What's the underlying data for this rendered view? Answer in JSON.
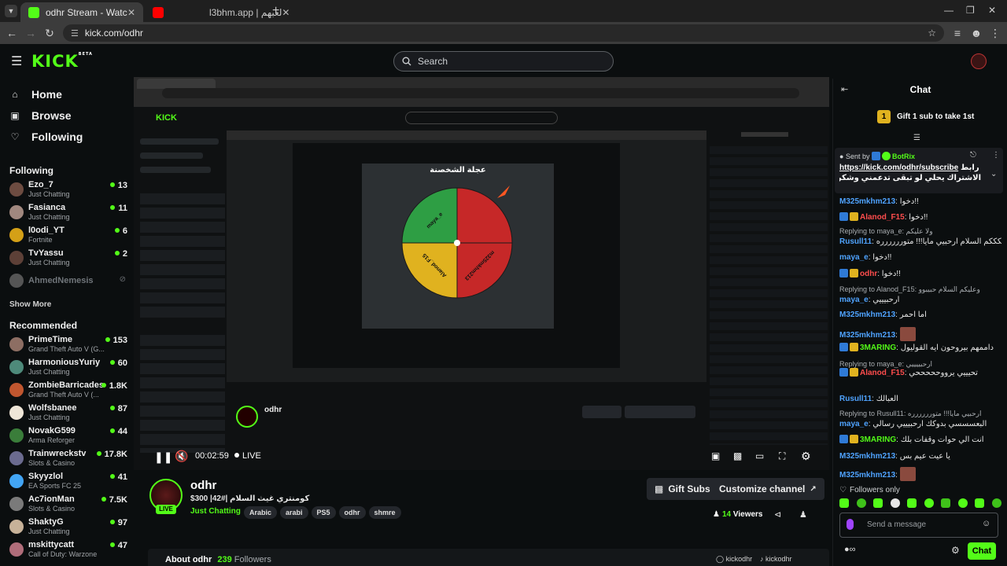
{
  "browser": {
    "tabs": [
      {
        "title": "odhr Stream - Watch Live on Ki",
        "active": true
      },
      {
        "title": "l3bhm.app | لعبهم",
        "active": false
      }
    ],
    "url": "kick.com/odhr",
    "new_tab": "+"
  },
  "header": {
    "logo": "KICK",
    "logo_badge": "BETA",
    "search_placeholder": "Search"
  },
  "sidebar": {
    "nav": [
      {
        "label": "Home",
        "icon": "home-icon"
      },
      {
        "label": "Browse",
        "icon": "browse-icon"
      },
      {
        "label": "Following",
        "icon": "heart-icon"
      }
    ],
    "following_title": "Following",
    "following": [
      {
        "name": "Ezo_7",
        "category": "Just Chatting",
        "viewers": "13",
        "color": "#6d4c41"
      },
      {
        "name": "Fasianca",
        "category": "Just Chatting",
        "viewers": "11",
        "color": "#a1887f"
      },
      {
        "name": "l0odi_YT",
        "category": "Fortnite",
        "viewers": "6",
        "color": "#d4a017"
      },
      {
        "name": "TvYassu",
        "category": "Just Chatting",
        "viewers": "2",
        "color": "#5d4037"
      },
      {
        "name": "AhmedNemesis",
        "category": "",
        "viewers": "",
        "color": "#555"
      }
    ],
    "show_more": "Show More",
    "recommended_title": "Recommended",
    "recommended": [
      {
        "name": "PrimeTime",
        "category": "Grand Theft Auto V (G...",
        "viewers": "153",
        "color": "#8d6e63"
      },
      {
        "name": "HarmoniousYuriy",
        "category": "Just Chatting",
        "viewers": "60",
        "color": "#4e8a7a"
      },
      {
        "name": "ZombieBarricades",
        "category": "Grand Theft Auto V (...",
        "viewers": "1.8K",
        "color": "#c0562f"
      },
      {
        "name": "Wolfsbanee",
        "category": "Just Chatting",
        "viewers": "87",
        "color": "#efe6d8"
      },
      {
        "name": "NovakG599",
        "category": "Arma Reforger",
        "viewers": "44",
        "color": "#3a7d3a"
      },
      {
        "name": "Trainwreckstv",
        "category": "Slots & Casino",
        "viewers": "17.8K",
        "color": "#6b6b8f"
      },
      {
        "name": "Skyyzlol",
        "category": "EA Sports FC 25",
        "viewers": "41",
        "color": "#42a5f5"
      },
      {
        "name": "Ac7ionMan",
        "category": "Slots & Casino",
        "viewers": "7.5K",
        "color": "#7a7a7a"
      },
      {
        "name": "ShaktyG",
        "category": "Just Chatting",
        "viewers": "97",
        "color": "#c7b299"
      },
      {
        "name": "mskittycatt",
        "category": "Call of Duty: Warzone",
        "viewers": "47",
        "color": "#b06d7a"
      }
    ]
  },
  "player": {
    "wheel_title": "عجلة الشخصنة",
    "wheel_segments": [
      {
        "label": "",
        "color": "#c62828"
      },
      {
        "label": "m325mkhm213",
        "color": "#c62828"
      },
      {
        "label": "Alanod_F15",
        "color": "#e0b21f"
      },
      {
        "label": "maya_e",
        "color": "#2e9e44"
      }
    ],
    "time": "00:02:59",
    "live_label": "LIVE"
  },
  "channel": {
    "name": "odhr",
    "title": "كومنتري غيث السلام |#42| 300$",
    "live_badge": "LIVE",
    "category": "Just Chatting",
    "tags": [
      "Arabic",
      "arabi",
      "PS5",
      "odhr",
      "shmre"
    ],
    "gift_subs": "Gift Subs",
    "customize": "Customize channel",
    "viewers": "14",
    "viewers_label": "Viewers",
    "about": "About odhr",
    "followers_count": "239",
    "followers_label": "Followers",
    "socials": [
      "kickodhr",
      "kickodhr"
    ]
  },
  "chat": {
    "title": "Chat",
    "gift_prompt": "Gift 1 sub to take 1st",
    "gift_rank": "1",
    "pinned": {
      "sent_by": "Sent by",
      "sender": "BotRix",
      "link": "https://kick.com/odhr/subscribe",
      "text_ar": "رابط",
      "text2": "الاشتراك يحلي لو تبقى تدعمني وشكرا لك مقدما ..."
    },
    "messages": [
      {
        "type": "msg",
        "user": "M325mkhm213",
        "color": "#4fa3ff",
        "text": "دخوا!!"
      },
      {
        "type": "msg",
        "user": "Alanod_F15",
        "color": "#ff4d4d",
        "text": "دخوا!!"
      },
      {
        "type": "reply",
        "text": "Replying to maya_e: ولا عليكم"
      },
      {
        "type": "msg",
        "user": "Rusull11",
        "color": "#4fa3ff",
        "text": "عليكككككم السلام ارحبيي مايا!!! متورررررره"
      },
      {
        "type": "msg",
        "user": "maya_e",
        "color": "#4fa3ff",
        "text": "دخوا!!"
      },
      {
        "type": "msg",
        "user": "odhr",
        "color": "#ff4d4d",
        "text": "دخوا!!"
      },
      {
        "type": "reply",
        "text": "Replying to Alanod_F15: وعليكم السلام حبيبوو"
      },
      {
        "type": "msg",
        "user": "maya_e",
        "color": "#4fa3ff",
        "text": "ارحبيييي"
      },
      {
        "type": "msg",
        "user": "M325mkhm213",
        "color": "#4fa3ff",
        "text": "اما احمر"
      },
      {
        "type": "msg",
        "user": "M325mkhm213",
        "color": "#4fa3ff",
        "text": ""
      },
      {
        "type": "msg",
        "user": "3MARING",
        "color": "#53fc18",
        "text": "داممهم بيروحون ايه القوليول"
      },
      {
        "type": "reply",
        "text": "Replying to maya_e: ارحبييييي"
      },
      {
        "type": "msg",
        "user": "Alanod_F15",
        "color": "#ff4d4d",
        "text": "تحيييي يرووحححححي"
      },
      {
        "type": "msg",
        "user": "Rusull11",
        "color": "#4fa3ff",
        "text": "العبالك"
      },
      {
        "type": "reply",
        "text": "Replying to Rusull11: ارحبيي مايا!!! متورررررره"
      },
      {
        "type": "msg",
        "user": "maya_e",
        "color": "#4fa3ff",
        "text": "البعسسسي بدوكك ارحبيييي رسالي"
      },
      {
        "type": "msg",
        "user": "3MARING",
        "color": "#53fc18",
        "text": "انت الي حوات وقفات بلك"
      },
      {
        "type": "msg",
        "user": "M325mkhm213",
        "color": "#4fa3ff",
        "text": "يا عيت عيم بس"
      },
      {
        "type": "msg",
        "user": "M325mkhm213",
        "color": "#4fa3ff",
        "text": ""
      }
    ],
    "followers_only": "Followers only",
    "placeholder": "Send a message",
    "send_label": "Chat"
  }
}
